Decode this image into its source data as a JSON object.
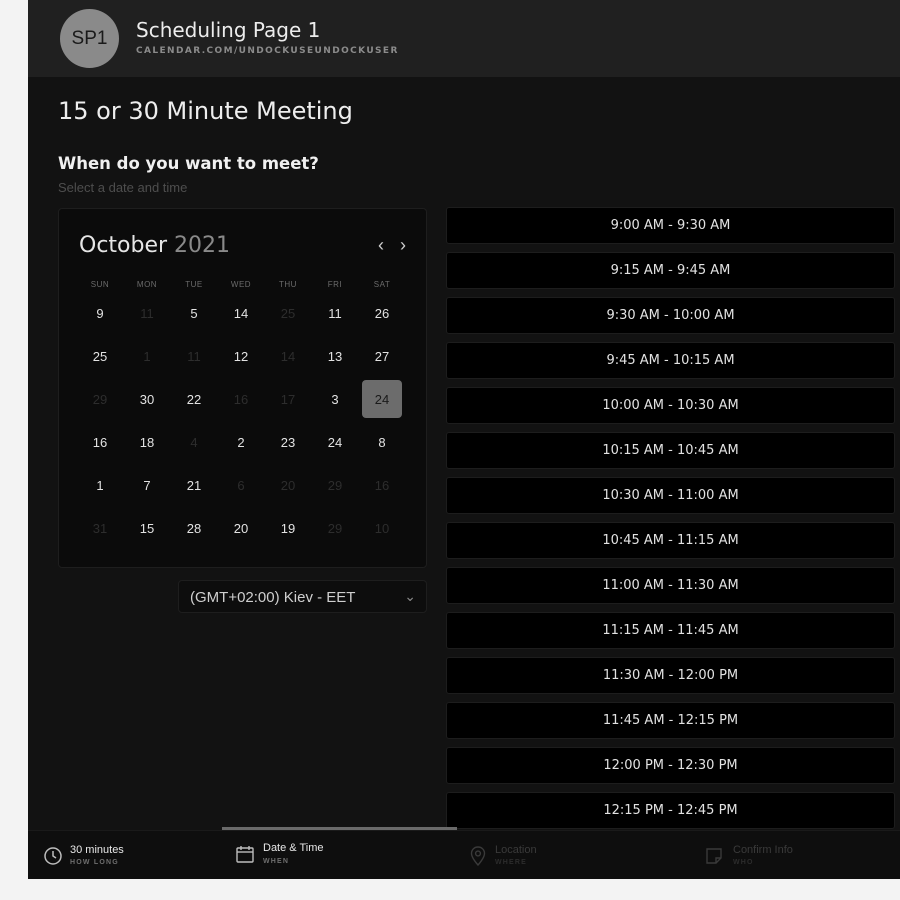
{
  "header": {
    "avatar_text": "SP1",
    "title": "Scheduling Page 1",
    "url": "CALENDAR.COM/UNDOCKUSEUNDOCKUSER"
  },
  "page": {
    "title": "15 or 30 Minute Meeting",
    "question": "When do you want to meet?",
    "subtitle": "Select a date and time"
  },
  "calendar": {
    "month": "October",
    "year": "2021",
    "prev_icon": "‹",
    "next_icon": "›",
    "weekdays": [
      "SUN",
      "MON",
      "TUE",
      "WED",
      "THU",
      "FRI",
      "SAT"
    ],
    "weeks": [
      [
        {
          "d": "9",
          "m": false
        },
        {
          "d": "11",
          "m": true
        },
        {
          "d": "5",
          "m": false
        },
        {
          "d": "14",
          "m": false
        },
        {
          "d": "25",
          "m": true
        },
        {
          "d": "11",
          "m": false
        },
        {
          "d": "26",
          "m": false
        }
      ],
      [
        {
          "d": "25",
          "m": false
        },
        {
          "d": "1",
          "m": true
        },
        {
          "d": "11",
          "m": true
        },
        {
          "d": "12",
          "m": false
        },
        {
          "d": "14",
          "m": true
        },
        {
          "d": "13",
          "m": false
        },
        {
          "d": "27",
          "m": false
        }
      ],
      [
        {
          "d": "29",
          "m": true
        },
        {
          "d": "30",
          "m": false
        },
        {
          "d": "22",
          "m": false
        },
        {
          "d": "16",
          "m": true
        },
        {
          "d": "17",
          "m": true
        },
        {
          "d": "3",
          "m": false
        },
        {
          "d": "24",
          "m": false,
          "selected": true
        }
      ],
      [
        {
          "d": "16",
          "m": false
        },
        {
          "d": "18",
          "m": false
        },
        {
          "d": "4",
          "m": true
        },
        {
          "d": "2",
          "m": false
        },
        {
          "d": "23",
          "m": false
        },
        {
          "d": "24",
          "m": false
        },
        {
          "d": "8",
          "m": false
        }
      ],
      [
        {
          "d": "1",
          "m": false
        },
        {
          "d": "7",
          "m": false
        },
        {
          "d": "21",
          "m": false
        },
        {
          "d": "6",
          "m": true
        },
        {
          "d": "20",
          "m": true
        },
        {
          "d": "29",
          "m": true
        },
        {
          "d": "16",
          "m": true
        }
      ],
      [
        {
          "d": "31",
          "m": true
        },
        {
          "d": "15",
          "m": false
        },
        {
          "d": "28",
          "m": false
        },
        {
          "d": "20",
          "m": false
        },
        {
          "d": "19",
          "m": false
        },
        {
          "d": "29",
          "m": true
        },
        {
          "d": "10",
          "m": true
        }
      ]
    ]
  },
  "timezone": {
    "label": "(GMT+02:00) Kiev - EET",
    "chevron": "⌄"
  },
  "slots": [
    "9:00 AM - 9:30 AM",
    "9:15 AM - 9:45 AM",
    "9:30 AM - 10:00 AM",
    "9:45 AM - 10:15 AM",
    "10:00 AM - 10:30 AM",
    "10:15 AM - 10:45 AM",
    "10:30 AM - 11:00 AM",
    "10:45 AM - 11:15 AM",
    "11:00 AM - 11:30 AM",
    "11:15 AM - 11:45 AM",
    "11:30 AM - 12:00 PM",
    "11:45 AM - 12:15 PM",
    "12:00 PM - 12:30 PM",
    "12:15 PM - 12:45 PM"
  ],
  "steps": [
    {
      "title": "30 minutes",
      "sub": "HOW LONG",
      "icon": "clock-icon",
      "state": "on"
    },
    {
      "title": "Date & Time",
      "sub": "WHEN",
      "icon": "calendar-icon",
      "state": "on"
    },
    {
      "title": "Location",
      "sub": "WHERE",
      "icon": "location-pin-icon",
      "state": "off"
    },
    {
      "title": "Confirm Info",
      "sub": "WHO",
      "icon": "note-icon",
      "state": "off"
    }
  ],
  "colors": {
    "background": "#121212",
    "header": "#202020",
    "selected_day": "#6c6c6c"
  }
}
